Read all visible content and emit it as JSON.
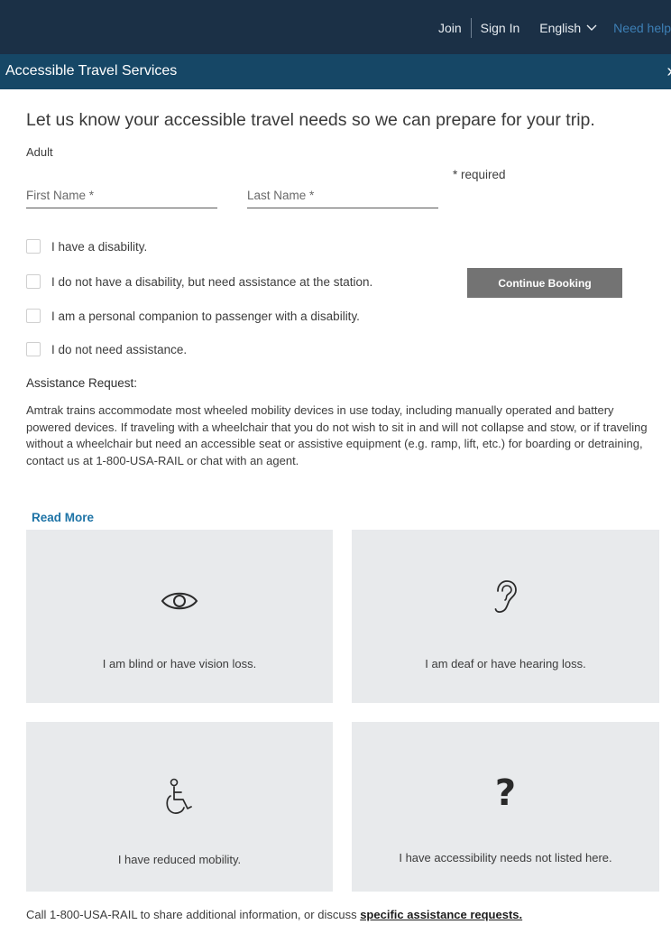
{
  "topnav": {
    "join": "Join",
    "sign_in": "Sign In",
    "language": "English",
    "help": "Need help"
  },
  "header": {
    "title": "Accessible Travel Services"
  },
  "form": {
    "lead": "Let us know your accessible travel needs so we can prepare for your trip.",
    "passenger_type": "Adult",
    "required_note": "* required",
    "first_name_placeholder": "First Name *",
    "last_name_placeholder": "Last Name *",
    "options": [
      {
        "label": "I have a disability.",
        "checked": false
      },
      {
        "label": "I do not have a disability, but need assistance at the station.",
        "checked": false
      },
      {
        "label": "I am a personal companion to passenger with a disability.",
        "checked": false
      },
      {
        "label": "I do not need assistance.",
        "checked": false
      }
    ],
    "continue_label": "Continue Booking"
  },
  "assistance": {
    "heading": "Assistance Request:",
    "body": "Amtrak trains accommodate most wheeled mobility devices in use today, including manually operated and battery powered devices. If traveling with a wheelchair that you do not wish to sit in and will not collapse and stow, or if traveling without a wheelchair but need an accessible seat or assistive equipment (e.g. ramp, lift, etc.) for boarding or detraining, contact us at 1-800-USA-RAIL or chat with an agent.",
    "read_more": "Read More"
  },
  "cards": [
    {
      "icon": "eye-icon",
      "label": "I am blind or have vision loss."
    },
    {
      "icon": "ear-icon",
      "label": "I am deaf or have hearing loss."
    },
    {
      "icon": "wheelchair-icon",
      "label": "I have reduced mobility."
    },
    {
      "icon": "question-icon",
      "symbol": "?",
      "label": "I have accessibility needs not listed here."
    }
  ],
  "footer": {
    "text": "Call 1-800-USA-RAIL to share additional information, or discuss ",
    "link": "specific assistance requests."
  },
  "colors": {
    "topbar": "#1b3046",
    "header": "#164766",
    "link": "#1d73a6",
    "button": "#737373",
    "card_bg": "#e8eaec"
  }
}
